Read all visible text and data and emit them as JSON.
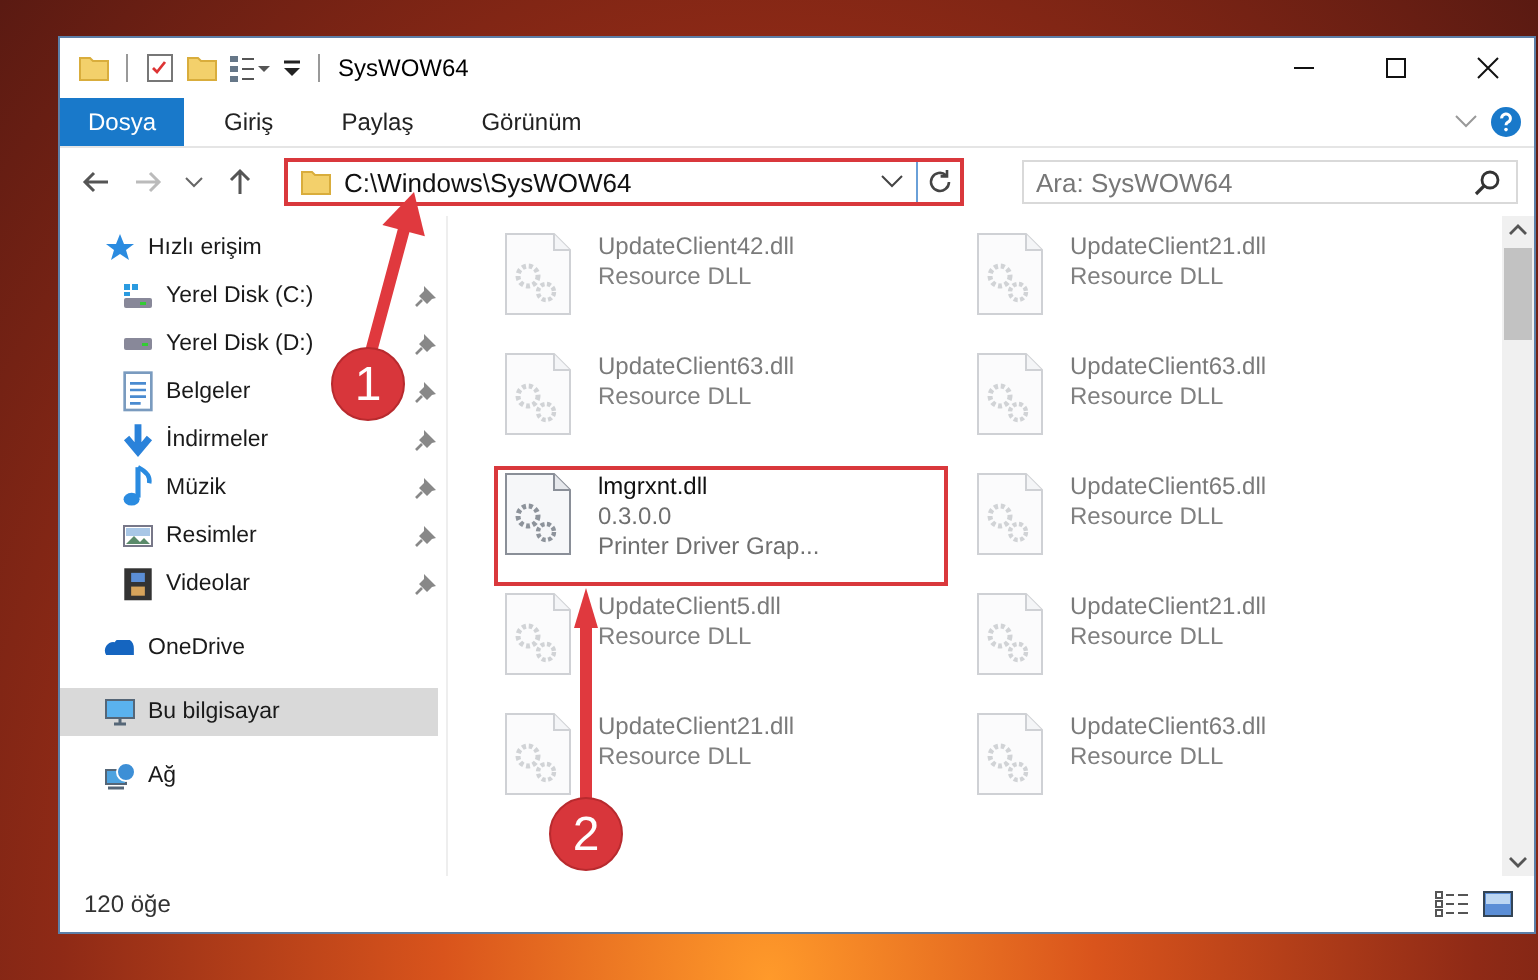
{
  "window": {
    "title": "SysWOW64"
  },
  "ribbon_tabs": [
    {
      "label": "Dosya",
      "selected": true
    },
    {
      "label": "Giriş",
      "selected": false
    },
    {
      "label": "Paylaş",
      "selected": false
    },
    {
      "label": "Görünüm",
      "selected": false
    }
  ],
  "address_bar": {
    "path": "C:\\Windows\\SysWOW64"
  },
  "search": {
    "placeholder": "Ara: SysWOW64"
  },
  "sidebar": {
    "items": [
      {
        "label": "Hızlı erişim",
        "selected": false,
        "children": [
          {
            "label": "Yerel Disk (C:)",
            "pinned": true,
            "selected": false
          },
          {
            "label": "Yerel Disk (D:)",
            "pinned": true,
            "selected": false
          },
          {
            "label": "Belgeler",
            "pinned": true,
            "selected": false
          },
          {
            "label": "İndirmeler",
            "pinned": true,
            "selected": false
          },
          {
            "label": "Müzik",
            "pinned": true,
            "selected": false
          },
          {
            "label": "Resimler",
            "pinned": true,
            "selected": false
          },
          {
            "label": "Videolar",
            "pinned": true,
            "selected": false
          }
        ]
      },
      {
        "label": "OneDrive",
        "selected": false
      },
      {
        "label": "Bu bilgisayar",
        "selected": true
      },
      {
        "label": "Ağ",
        "selected": false
      }
    ]
  },
  "files": [
    {
      "name": "UpdateClient42.dll",
      "detail_1": "Resource DLL",
      "faded": true
    },
    {
      "name": "UpdateClient21.dll",
      "detail_1": "Resource DLL",
      "faded": true
    },
    {
      "name": "UpdateClient63.dll",
      "detail_1": "Resource DLL",
      "faded": true
    },
    {
      "name": "UpdateClient63.dll",
      "detail_1": "Resource DLL",
      "faded": true
    },
    {
      "name": "lmgrxnt.dll",
      "detail_1": "0.3.0.0",
      "detail_2": "Printer Driver Grap...",
      "faded": false
    },
    {
      "name": "UpdateClient65.dll",
      "detail_1": "Resource DLL",
      "faded": true
    },
    {
      "name": "UpdateClient5.dll",
      "detail_1": "Resource DLL",
      "faded": true
    },
    {
      "name": "UpdateClient21.dll",
      "detail_1": "Resource DLL",
      "faded": true
    },
    {
      "name": "UpdateClient21.dll",
      "detail_1": "Resource DLL",
      "faded": true
    },
    {
      "name": "UpdateClient63.dll",
      "detail_1": "Resource DLL",
      "faded": true
    }
  ],
  "status_bar": {
    "item_count": "120 öğe"
  },
  "annotations": [
    {
      "number": "1"
    },
    {
      "number": "2"
    }
  ]
}
